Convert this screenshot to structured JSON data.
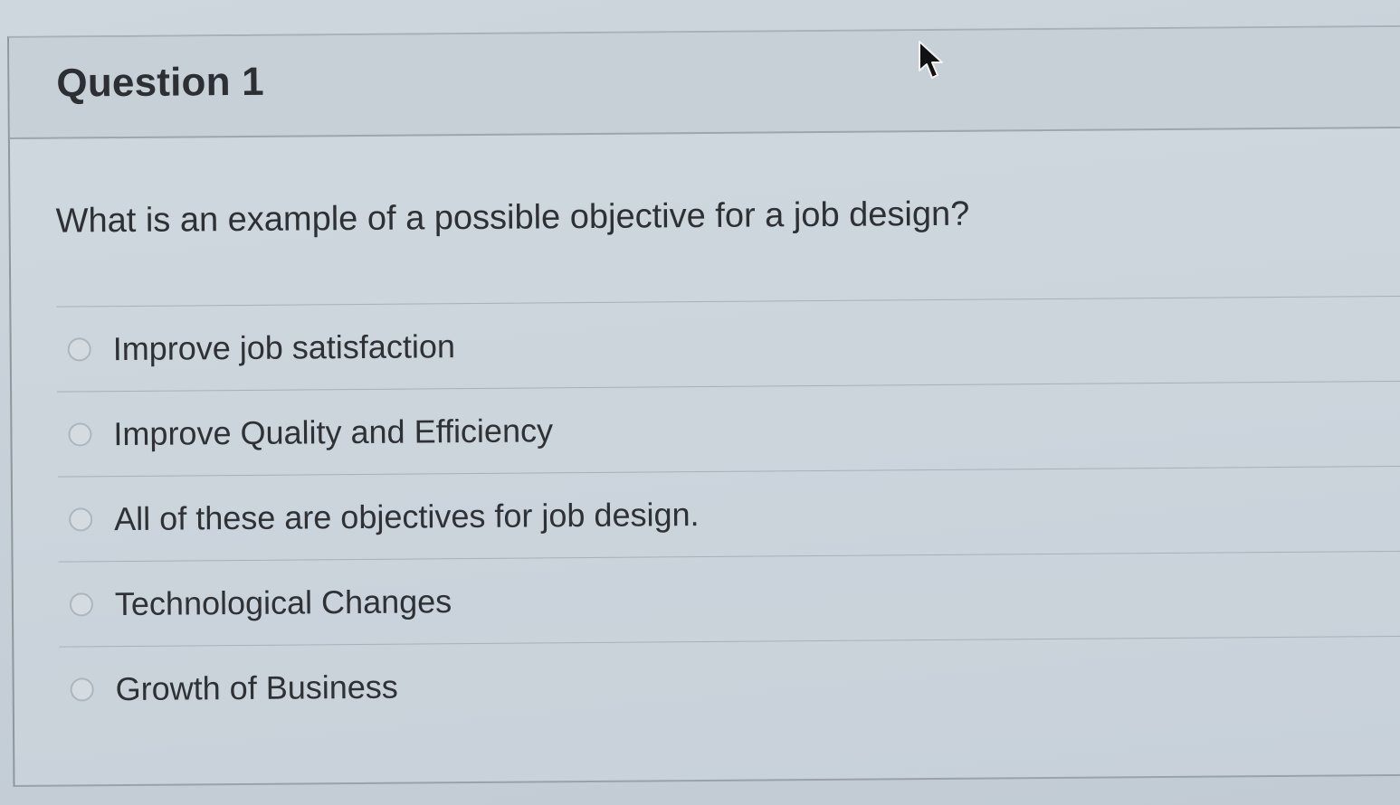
{
  "question": {
    "title": "Question 1",
    "text": "What is an example of a possible objective for a job design?",
    "answers": [
      {
        "label": "Improve job satisfaction",
        "selected": false
      },
      {
        "label": "Improve Quality and Efficiency",
        "selected": false
      },
      {
        "label": "All of these are objectives for job design.",
        "selected": false
      },
      {
        "label": "Technological Changes",
        "selected": false
      },
      {
        "label": "Growth of Business",
        "selected": false
      }
    ]
  },
  "icons": {
    "cursor": "mouse-pointer-icon",
    "radio": "radio-button-unselected"
  },
  "colors": {
    "background": "#c9d2d9",
    "text": "#2d3034",
    "divider": "#a8b0b7"
  }
}
